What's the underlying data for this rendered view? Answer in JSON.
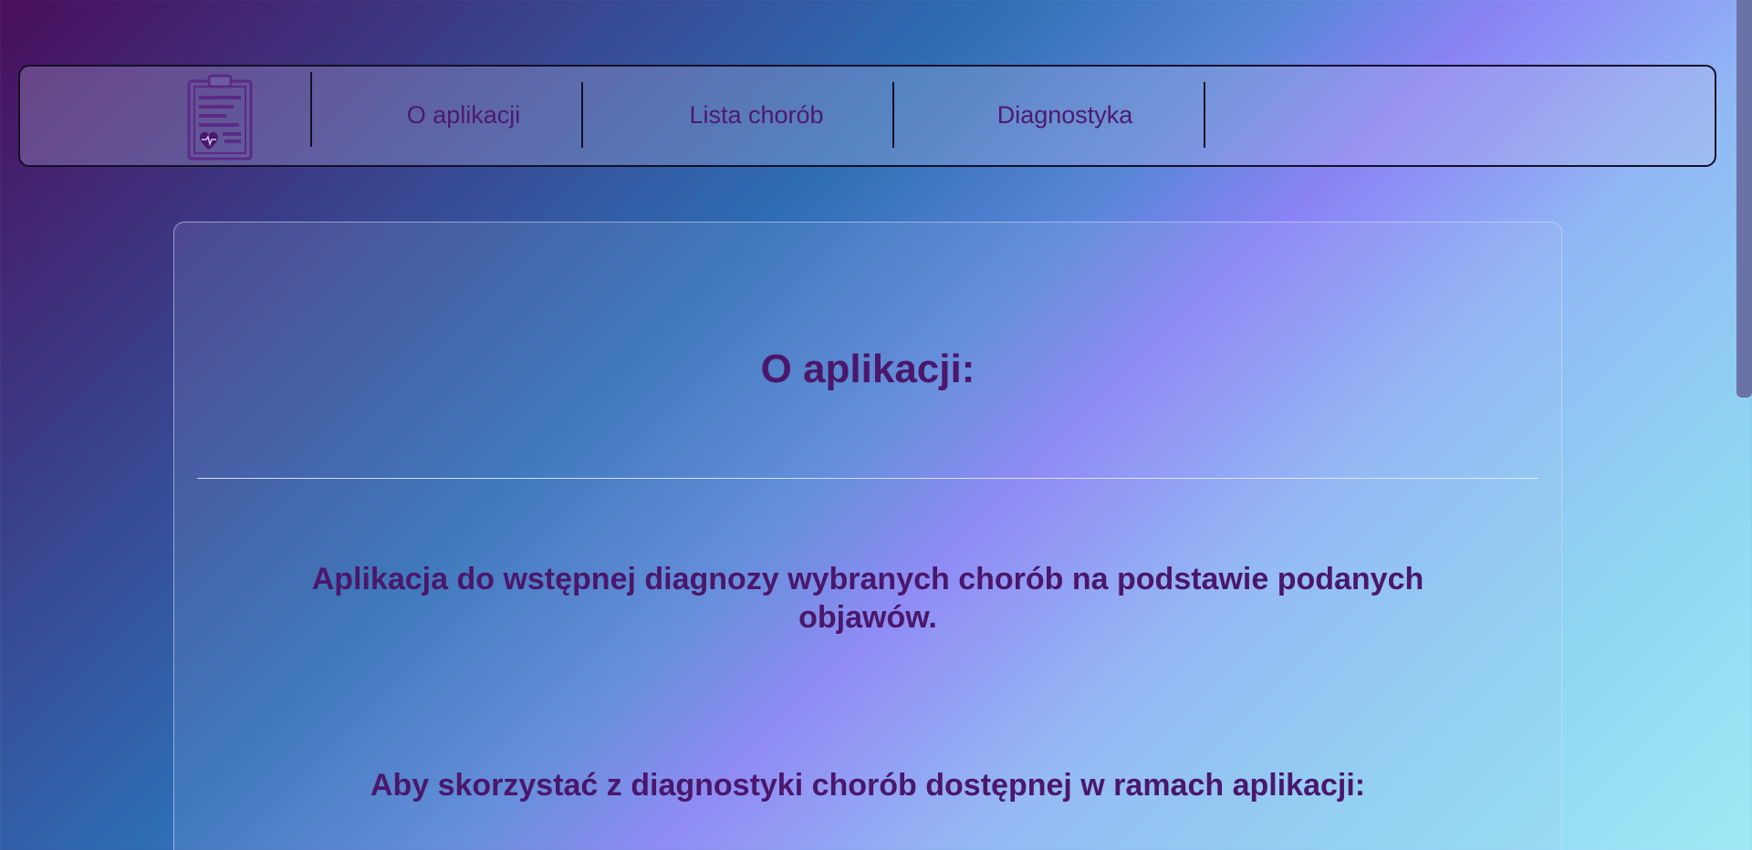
{
  "nav": {
    "logo_icon": "clipboard-heart-icon",
    "links": [
      {
        "label": "O aplikacji"
      },
      {
        "label": "Lista chorób"
      },
      {
        "label": "Diagnostyka"
      }
    ]
  },
  "main": {
    "title": "O aplikacji:",
    "description": "Aplikacja do wstępnej diagnozy wybranych chorób na podstawie podanych objawów.",
    "instruction": "Aby skorzystać z diagnostyki chorób dostępnej w ramach aplikacji:"
  },
  "colors": {
    "text_accent": "#4a176b",
    "nav_border": "#141028",
    "gradient": [
      "#4a0e5c",
      "#2e6db4",
      "#8b83f5",
      "#9fe9f5"
    ]
  },
  "scrollbar": {
    "thumb_fraction": 0.47
  }
}
